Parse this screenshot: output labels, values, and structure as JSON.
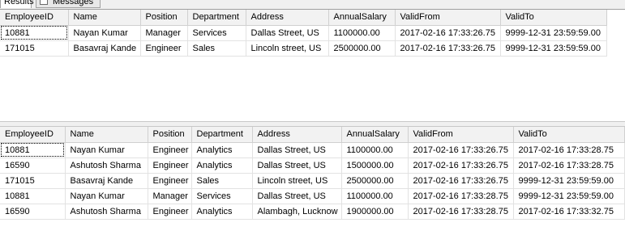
{
  "tabs": [
    {
      "label": "Results",
      "icon": "grid-icon"
    },
    {
      "label": "Messages",
      "icon": "messages-icon"
    }
  ],
  "grid1": {
    "columns": [
      "EmployeeID",
      "Name",
      "Position",
      "Department",
      "Address",
      "AnnualSalary",
      "ValidFrom",
      "ValidTo"
    ],
    "rows": [
      [
        "10881",
        "Nayan Kumar",
        "Manager",
        "Services",
        "Dallas Street, US",
        "1100000.00",
        "2017-02-16 17:33:26.75",
        "9999-12-31 23:59:59.00"
      ],
      [
        "171015",
        "Basavraj Kande",
        "Engineer",
        "Sales",
        "Lincoln street, US",
        "2500000.00",
        "2017-02-16 17:33:26.75",
        "9999-12-31 23:59:59.00"
      ]
    ]
  },
  "grid2": {
    "columns": [
      "EmployeeID",
      "Name",
      "Position",
      "Department",
      "Address",
      "AnnualSalary",
      "ValidFrom",
      "ValidTo"
    ],
    "rows": [
      [
        "10881",
        "Nayan Kumar",
        "Engineer",
        "Analytics",
        "Dallas Street, US",
        "1100000.00",
        "2017-02-16 17:33:26.75",
        "2017-02-16 17:33:28.75"
      ],
      [
        "16590",
        "Ashutosh Sharma",
        "Engineer",
        "Analytics",
        "Dallas Street, US",
        "1500000.00",
        "2017-02-16 17:33:26.75",
        "2017-02-16 17:33:28.75"
      ],
      [
        "171015",
        "Basavraj Kande",
        "Engineer",
        "Sales",
        "Lincoln street, US",
        "2500000.00",
        "2017-02-16 17:33:26.75",
        "9999-12-31 23:59:59.00"
      ],
      [
        "10881",
        "Nayan Kumar",
        "Manager",
        "Services",
        "Dallas Street, US",
        "1100000.00",
        "2017-02-16 17:33:28.75",
        "9999-12-31 23:59:59.00"
      ],
      [
        "16590",
        "Ashutosh Sharma",
        "Engineer",
        "Analytics",
        "Alambagh, Lucknow",
        "1900000.00",
        "2017-02-16 17:33:28.75",
        "2017-02-16 17:33:32.75"
      ]
    ]
  }
}
